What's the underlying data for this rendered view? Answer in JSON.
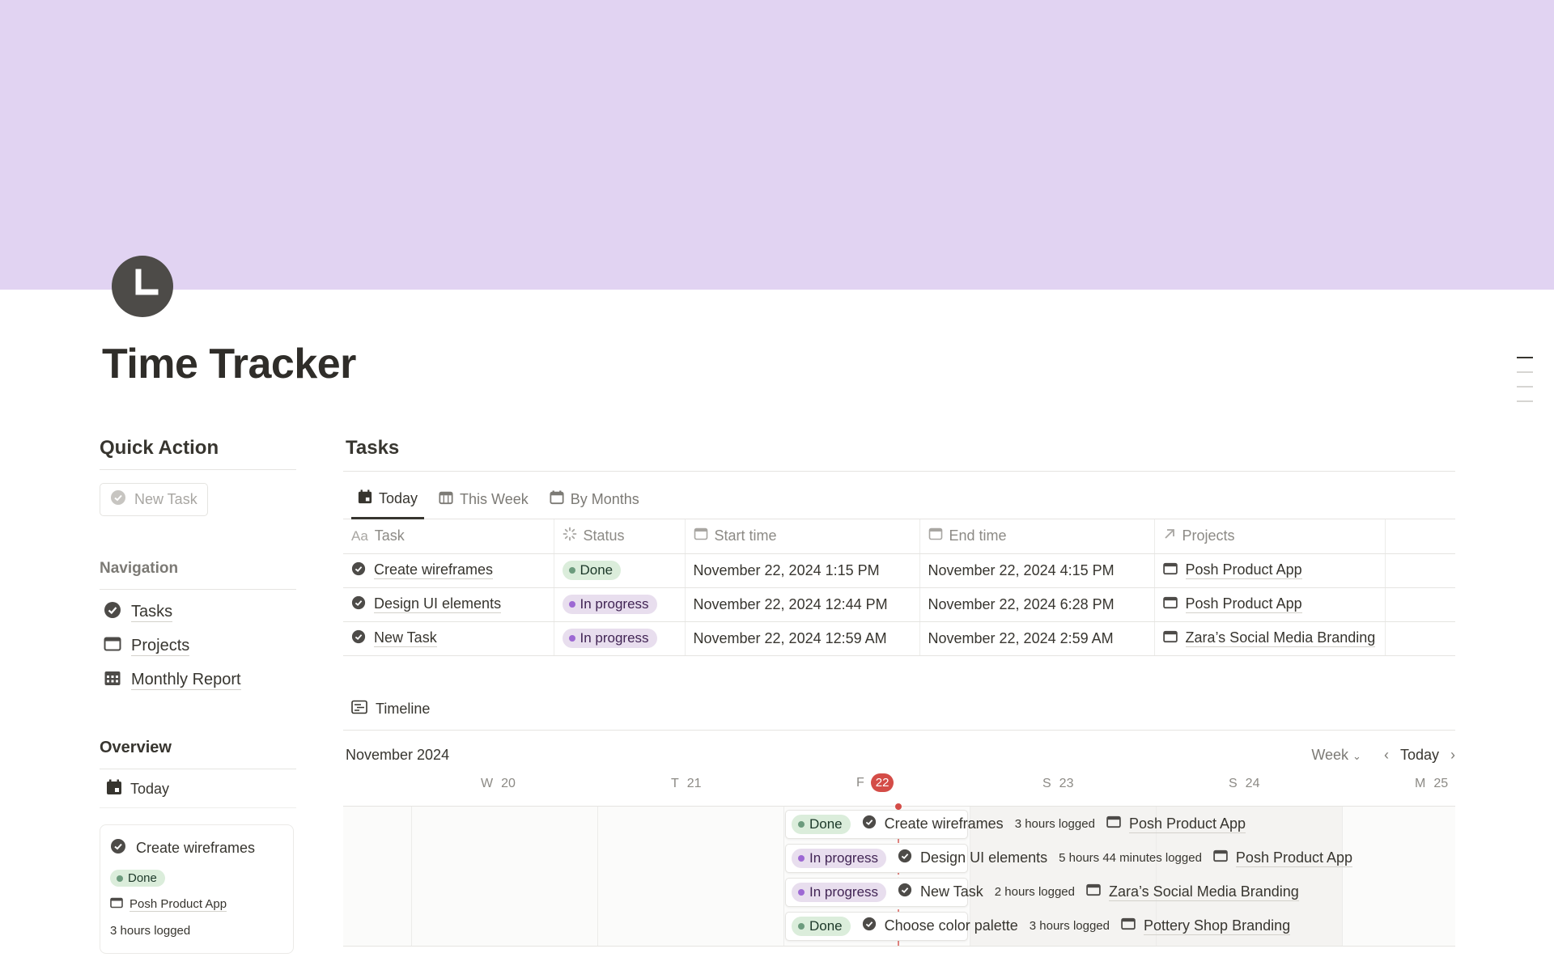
{
  "colors": {
    "cover": "#e1d3f2",
    "accent_today": "#d44c47",
    "done_bg": "#dbeddb",
    "progress_bg": "#e8deee"
  },
  "page": {
    "title": "Time Tracker",
    "icon": "clock-icon"
  },
  "quick_action": {
    "heading": "Quick Action",
    "button_label": "New Task"
  },
  "navigation": {
    "heading": "Navigation",
    "items": [
      {
        "label": "Tasks",
        "icon": "check-circle-icon"
      },
      {
        "label": "Projects",
        "icon": "window-icon"
      },
      {
        "label": "Monthly Report",
        "icon": "calendar-grid-icon"
      }
    ]
  },
  "overview": {
    "heading": "Overview",
    "tab": "Today",
    "card": {
      "title": "Create wireframes",
      "status": "Done",
      "project": "Posh Product App",
      "hours": "3 hours logged"
    }
  },
  "tasks": {
    "heading": "Tasks",
    "views": [
      "Today",
      "This Week",
      "By Months"
    ],
    "columns": [
      "Task",
      "Status",
      "Start time",
      "End time",
      "Projects"
    ],
    "rows": [
      {
        "task": "Create wireframes",
        "status": "Done",
        "start": "November 22, 2024 1:15 PM",
        "end": "November 22, 2024 4:15 PM",
        "project": "Posh Product App"
      },
      {
        "task": "Design UI elements",
        "status": "In progress",
        "start": "November 22, 2024 12:44 PM",
        "end": "November 22, 2024 6:28 PM",
        "project": "Posh Product App"
      },
      {
        "task": "New Task",
        "status": "In progress",
        "start": "November 22, 2024 12:59 AM",
        "end": "November 22, 2024 2:59 AM",
        "project": "Zara’s Social Media Branding"
      }
    ]
  },
  "timeline": {
    "heading": "Timeline",
    "month": "November 2024",
    "scale": "Week",
    "today_button": "Today",
    "days": [
      {
        "letter": "W",
        "num": "20"
      },
      {
        "letter": "T",
        "num": "21"
      },
      {
        "letter": "F",
        "num": "22"
      },
      {
        "letter": "S",
        "num": "23"
      },
      {
        "letter": "S",
        "num": "24"
      },
      {
        "letter": "M",
        "num": "25"
      }
    ],
    "items": [
      {
        "status": "Done",
        "task": "Create wireframes",
        "logged": "3 hours logged",
        "project": "Posh Product App"
      },
      {
        "status": "In progress",
        "task": "Design UI elements",
        "logged": "5 hours 44 minutes logged",
        "project": "Posh Product App"
      },
      {
        "status": "In progress",
        "task": "New Task",
        "logged": "2 hours logged",
        "project": "Zara’s Social Media Branding"
      },
      {
        "status": "Done",
        "task": "Choose color palette",
        "logged": "3 hours logged",
        "project": "Pottery Shop Branding"
      }
    ]
  }
}
